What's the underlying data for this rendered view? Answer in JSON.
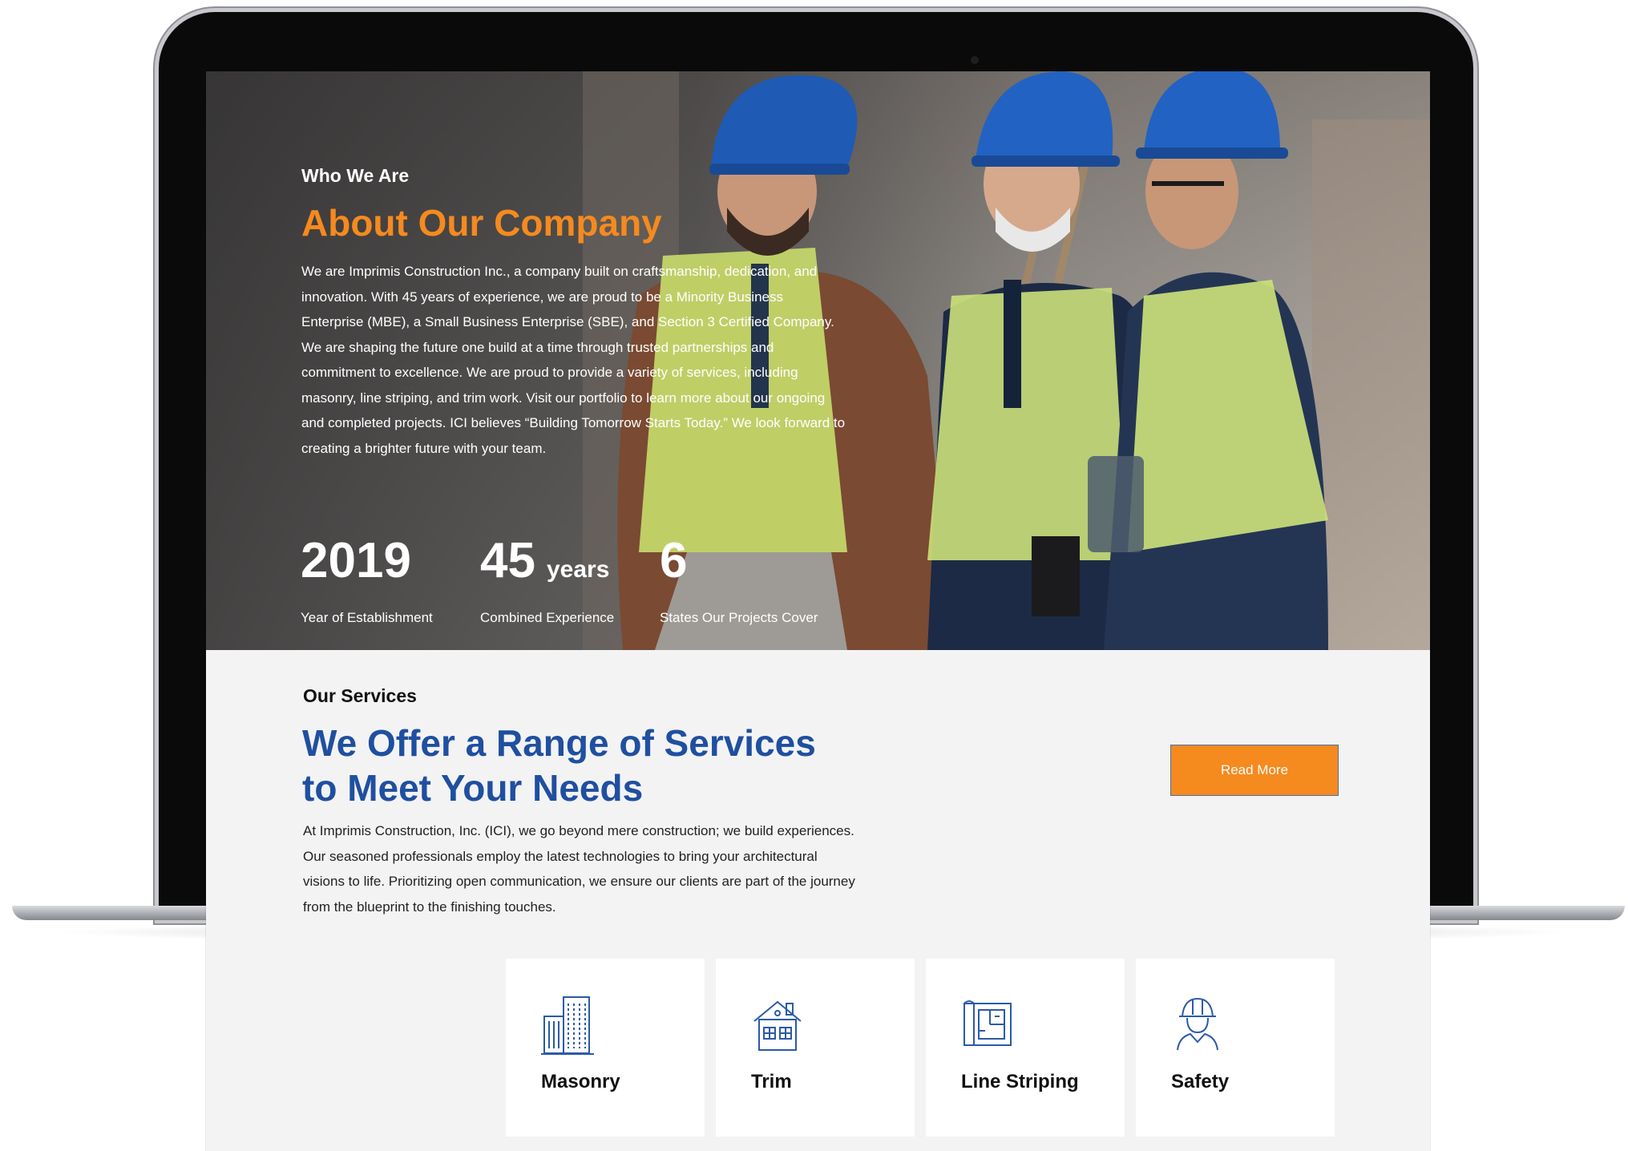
{
  "hero": {
    "eyebrow": "Who We Are",
    "title": "About Our Company",
    "body": "We are Imprimis Construction Inc., a company built on craftsmanship, dedication, and innovation. With 45 years of experience, we are proud to be a Minority Business Enterprise (MBE), a Small Business Enterprise (SBE), and Section 3 Certified Company. We are shaping the future one build at a time through trusted partnerships and commitment to excellence. We are proud to provide a variety of services, including masonry, line striping, and trim work. Visit our portfolio to learn more about our ongoing and completed projects. ICI believes “Building Tomorrow Starts Today.” We look forward to creating a brighter future with your team.",
    "stats": [
      {
        "value": "2019",
        "unit": "",
        "label": "Year of Establishment"
      },
      {
        "value": "45",
        "unit": "years",
        "label": "Combined Experience"
      },
      {
        "value": "6",
        "unit": "",
        "label": "States Our Projects Cover"
      }
    ]
  },
  "services": {
    "eyebrow": "Our Services",
    "title_line1": "We Offer a Range of Services",
    "title_line2": "to Meet Your Needs",
    "body": "At Imprimis Construction, Inc. (ICI), we go beyond mere construction; we build experiences. Our seasoned professionals employ the latest technologies to bring your architectural visions to life. Prioritizing open communication, we ensure our clients are part of the journey from the blueprint to the finishing touches.",
    "read_more": "Read More",
    "cards": [
      {
        "label": "Masonry",
        "icon": "building-icon"
      },
      {
        "label": "Trim",
        "icon": "house-icon"
      },
      {
        "label": "Line Striping",
        "icon": "blueprint-icon"
      },
      {
        "label": "Safety",
        "icon": "worker-helmet-icon"
      }
    ]
  },
  "colors": {
    "accent_orange": "#f58a1f",
    "brand_blue": "#1f4fa0",
    "icon_blue": "#2b5aa8",
    "services_bg": "#f3f3f4"
  }
}
